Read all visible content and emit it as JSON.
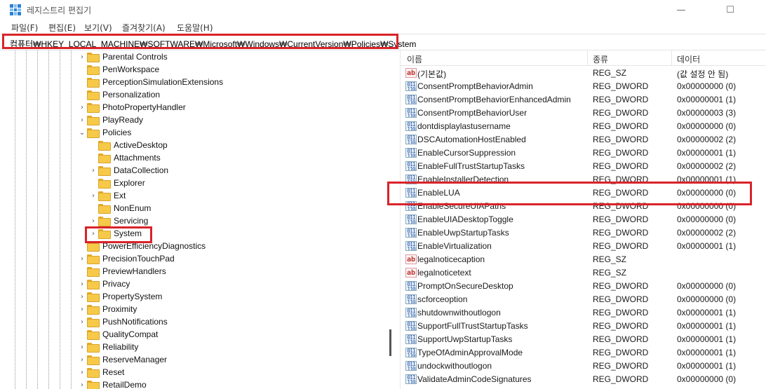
{
  "window": {
    "title": "레지스트리 편집기",
    "minimize": "—",
    "maximize": "☐"
  },
  "menu": [
    "파일(F)",
    "편집(E)",
    "보기(V)",
    "즐겨찾기(A)",
    "도움말(H)"
  ],
  "address": {
    "path": "컴퓨터₩HKEY_LOCAL_MACHINE₩SOFTWARE₩Microsoft₩Windows₩CurrentVersion₩Policies₩System"
  },
  "tree": [
    {
      "label": "Parental Controls",
      "level": 0,
      "chevron": ">"
    },
    {
      "label": "PenWorkspace",
      "level": 0,
      "chevron": ""
    },
    {
      "label": "PerceptionSimulationExtensions",
      "level": 0,
      "chevron": ""
    },
    {
      "label": "Personalization",
      "level": 0,
      "chevron": ""
    },
    {
      "label": "PhotoPropertyHandler",
      "level": 0,
      "chevron": ">"
    },
    {
      "label": "PlayReady",
      "level": 0,
      "chevron": ">"
    },
    {
      "label": "Policies",
      "level": 0,
      "chevron": "v"
    },
    {
      "label": "ActiveDesktop",
      "level": 1,
      "chevron": ""
    },
    {
      "label": "Attachments",
      "level": 1,
      "chevron": ""
    },
    {
      "label": "DataCollection",
      "level": 1,
      "chevron": ">"
    },
    {
      "label": "Explorer",
      "level": 1,
      "chevron": ""
    },
    {
      "label": "Ext",
      "level": 1,
      "chevron": ">"
    },
    {
      "label": "NonEnum",
      "level": 1,
      "chevron": ""
    },
    {
      "label": "Servicing",
      "level": 1,
      "chevron": ">"
    },
    {
      "label": "System",
      "level": 1,
      "chevron": ">"
    },
    {
      "label": "PowerEfficiencyDiagnostics",
      "level": 0,
      "chevron": ""
    },
    {
      "label": "PrecisionTouchPad",
      "level": 0,
      "chevron": ">"
    },
    {
      "label": "PreviewHandlers",
      "level": 0,
      "chevron": ""
    },
    {
      "label": "Privacy",
      "level": 0,
      "chevron": ">"
    },
    {
      "label": "PropertySystem",
      "level": 0,
      "chevron": ">"
    },
    {
      "label": "Proximity",
      "level": 0,
      "chevron": ">"
    },
    {
      "label": "PushNotifications",
      "level": 0,
      "chevron": ">"
    },
    {
      "label": "QualityCompat",
      "level": 0,
      "chevron": ""
    },
    {
      "label": "Reliability",
      "level": 0,
      "chevron": ">"
    },
    {
      "label": "ReserveManager",
      "level": 0,
      "chevron": ">"
    },
    {
      "label": "Reset",
      "level": 0,
      "chevron": ">"
    },
    {
      "label": "RetailDemo",
      "level": 0,
      "chevron": ">"
    }
  ],
  "columns": {
    "name": "이름",
    "type": "종류",
    "data": "데이터"
  },
  "values": [
    {
      "name": "(기본값)",
      "type": "REG_SZ",
      "data": "(값 설정 안 됨)",
      "icon": "sz"
    },
    {
      "name": "ConsentPromptBehaviorAdmin",
      "type": "REG_DWORD",
      "data": "0x00000000 (0)",
      "icon": "dword"
    },
    {
      "name": "ConsentPromptBehaviorEnhancedAdmin",
      "type": "REG_DWORD",
      "data": "0x00000001 (1)",
      "icon": "dword"
    },
    {
      "name": "ConsentPromptBehaviorUser",
      "type": "REG_DWORD",
      "data": "0x00000003 (3)",
      "icon": "dword"
    },
    {
      "name": "dontdisplaylastusername",
      "type": "REG_DWORD",
      "data": "0x00000000 (0)",
      "icon": "dword"
    },
    {
      "name": "DSCAutomationHostEnabled",
      "type": "REG_DWORD",
      "data": "0x00000002 (2)",
      "icon": "dword"
    },
    {
      "name": "EnableCursorSuppression",
      "type": "REG_DWORD",
      "data": "0x00000001 (1)",
      "icon": "dword"
    },
    {
      "name": "EnableFullTrustStartupTasks",
      "type": "REG_DWORD",
      "data": "0x00000002 (2)",
      "icon": "dword"
    },
    {
      "name": "EnableInstallerDetection",
      "type": "REG_DWORD",
      "data": "0x00000001 (1)",
      "icon": "dword"
    },
    {
      "name": "EnableLUA",
      "type": "REG_DWORD",
      "data": "0x00000000 (0)",
      "icon": "dword"
    },
    {
      "name": "EnableSecureUIAPaths",
      "type": "REG_DWORD",
      "data": "0x00000000 (0)",
      "icon": "dword"
    },
    {
      "name": "EnableUIADesktopToggle",
      "type": "REG_DWORD",
      "data": "0x00000000 (0)",
      "icon": "dword"
    },
    {
      "name": "EnableUwpStartupTasks",
      "type": "REG_DWORD",
      "data": "0x00000002 (2)",
      "icon": "dword"
    },
    {
      "name": "EnableVirtualization",
      "type": "REG_DWORD",
      "data": "0x00000001 (1)",
      "icon": "dword"
    },
    {
      "name": "legalnoticecaption",
      "type": "REG_SZ",
      "data": "",
      "icon": "sz"
    },
    {
      "name": "legalnoticetext",
      "type": "REG_SZ",
      "data": "",
      "icon": "sz"
    },
    {
      "name": "PromptOnSecureDesktop",
      "type": "REG_DWORD",
      "data": "0x00000000 (0)",
      "icon": "dword"
    },
    {
      "name": "scforceoption",
      "type": "REG_DWORD",
      "data": "0x00000000 (0)",
      "icon": "dword"
    },
    {
      "name": "shutdownwithoutlogon",
      "type": "REG_DWORD",
      "data": "0x00000001 (1)",
      "icon": "dword"
    },
    {
      "name": "SupportFullTrustStartupTasks",
      "type": "REG_DWORD",
      "data": "0x00000001 (1)",
      "icon": "dword"
    },
    {
      "name": "SupportUwpStartupTasks",
      "type": "REG_DWORD",
      "data": "0x00000001 (1)",
      "icon": "dword"
    },
    {
      "name": "TypeOfAdminApprovalMode",
      "type": "REG_DWORD",
      "data": "0x00000001 (1)",
      "icon": "dword"
    },
    {
      "name": "undockwithoutlogon",
      "type": "REG_DWORD",
      "data": "0x00000001 (1)",
      "icon": "dword"
    },
    {
      "name": "ValidateAdminCodeSignatures",
      "type": "REG_DWORD",
      "data": "0x00000000 (0)",
      "icon": "dword"
    }
  ],
  "colors": {
    "highlight_box": "#d9232a",
    "folder": "#f7c948"
  }
}
